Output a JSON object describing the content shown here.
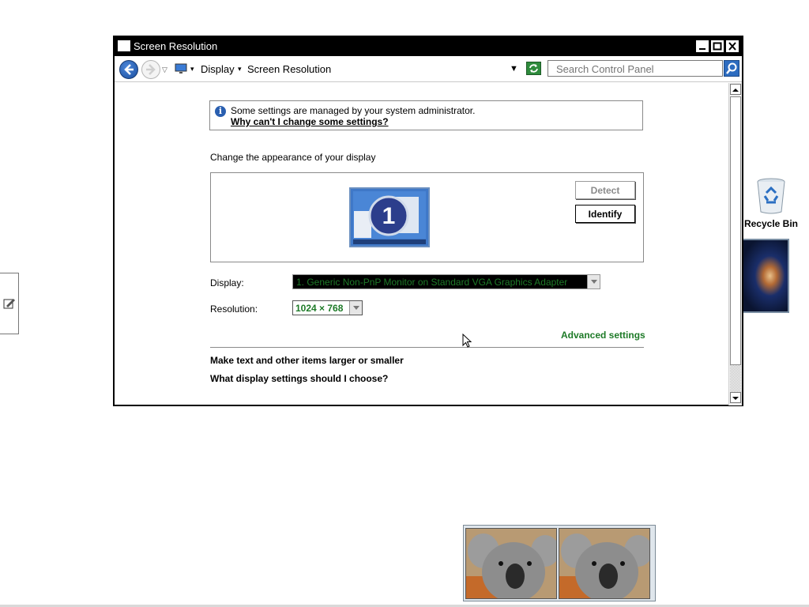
{
  "window": {
    "title": "Screen Resolution",
    "breadcrumb": [
      "Display",
      "Screen Resolution"
    ],
    "search_placeholder": "Search Control Panel"
  },
  "info": {
    "message": "Some settings are managed by your system administrator.",
    "link": "Why can't I change some settings?"
  },
  "main": {
    "heading": "Change the appearance of your display",
    "monitor_number": "1",
    "detect_label": "Detect",
    "identify_label": "Identify",
    "display_label": "Display:",
    "display_value": "1. Generic Non-PnP Monitor on Standard VGA Graphics Adapter",
    "resolution_label": "Resolution:",
    "resolution_value": "1024 × 768",
    "advanced_link": "Advanced settings",
    "link_text_size": "Make text and other items larger or smaller",
    "link_which_settings": "What display settings should I choose?"
  },
  "desktop": {
    "recycle_bin_label": "Recycle Bin"
  },
  "colors": {
    "accent_green": "#1d7a27",
    "titlebar": "#000000"
  }
}
